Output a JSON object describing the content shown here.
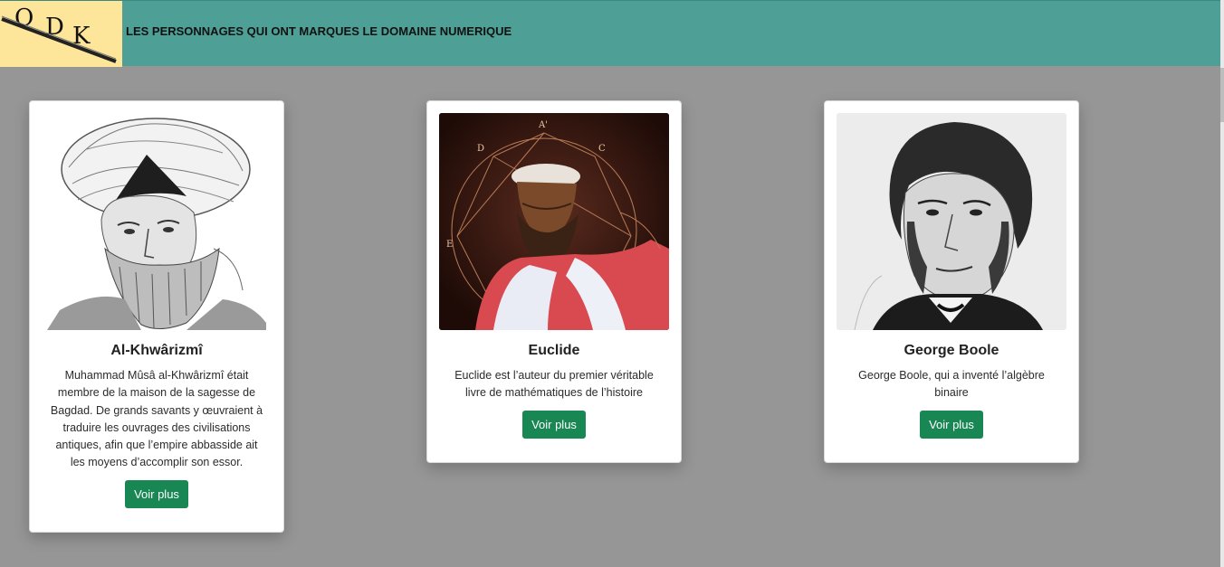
{
  "header": {
    "logo": {
      "letters": [
        "O",
        "D",
        "K"
      ]
    },
    "title": "LES PERSONNAGES QUI ONT MARQUES LE DOMAINE NUMERIQUE",
    "colors": {
      "bar": "#4ea096",
      "logo_bg": "#fde69a"
    }
  },
  "cards": [
    {
      "name": "Al-Khwârizmî",
      "description": "Muhammad Mûsâ al-Khwârizmî était membre de la maison de la sagesse de Bagdad. De grands savants y œuvraient à traduire les ouvrages des civilisations antiques, afin que l’empire abbasside ait les moyens d’accomplir son essor.",
      "button": "Voir plus",
      "portrait": "engraved-portrait-turban"
    },
    {
      "name": "Euclide",
      "description": "Euclide est l’auteur du premier véritable livre de mathématiques de l’histoire",
      "button": "Voir plus",
      "portrait": "painted-portrait-geometry",
      "figure_labels": [
        "A'",
        "D",
        "C",
        "E"
      ]
    },
    {
      "name": "George Boole",
      "description": "George Boole, qui a inventé l’algèbre binaire",
      "button": "Voir plus",
      "portrait": "engraved-portrait"
    }
  ],
  "theme": {
    "page_bg": "#969696",
    "button_bg": "#198754"
  }
}
